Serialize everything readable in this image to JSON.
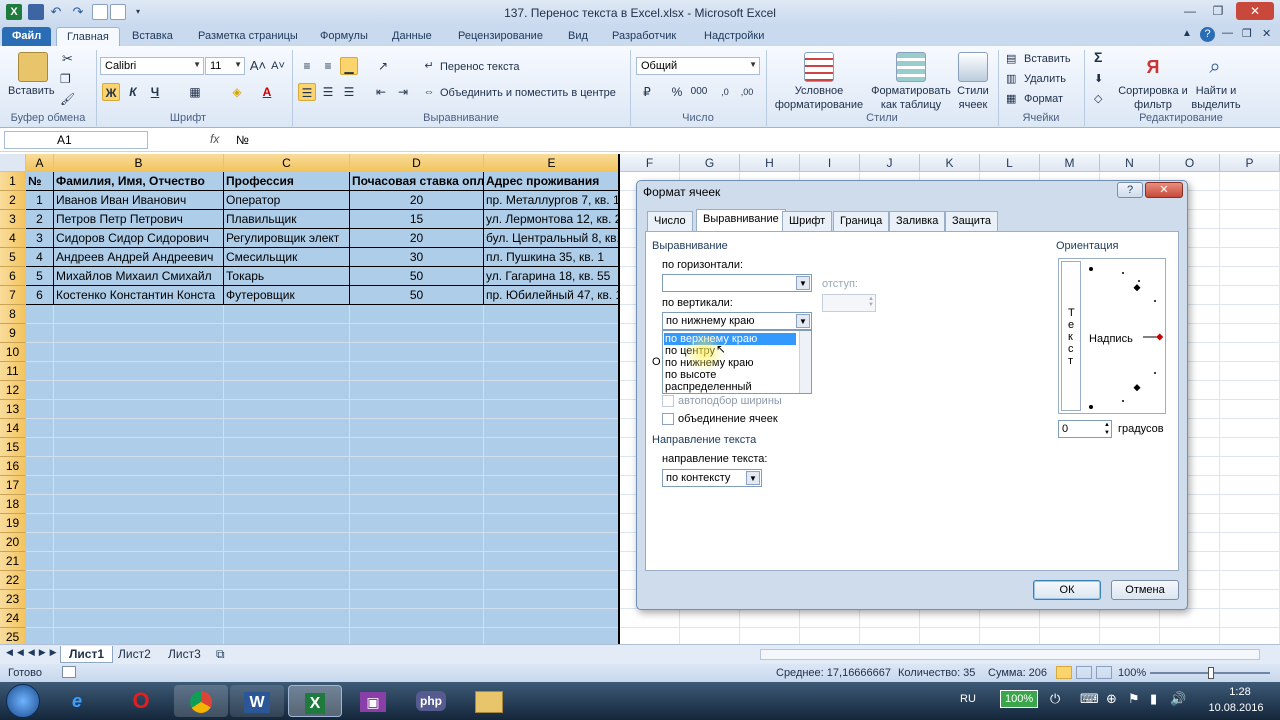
{
  "window": {
    "title": "137. Перенос текста в Excel.xlsx - Microsoft Excel"
  },
  "ribbon_tabs": [
    "Файл",
    "Главная",
    "Вставка",
    "Разметка страницы",
    "Формулы",
    "Данные",
    "Рецензирование",
    "Вид",
    "Разработчик",
    "Надстройки"
  ],
  "ribbon": {
    "clipboard": {
      "paste": "Вставить",
      "label": "Буфер обмена"
    },
    "font": {
      "name": "Calibri",
      "size": "11",
      "bold": "Ж",
      "italic": "К",
      "underline": "Ч",
      "label": "Шрифт"
    },
    "alignment": {
      "wrap": "Перенос текста",
      "merge": "Объединить и поместить в центре",
      "label": "Выравнивание"
    },
    "number": {
      "format": "Общий",
      "label": "Число"
    },
    "styles": {
      "conditional": "Условное форматирование",
      "as_table": "Форматировать как таблицу",
      "cell_styles": "Стили ячеек",
      "label": "Стили"
    },
    "cells": {
      "insert": "Вставить",
      "delete": "Удалить",
      "format": "Формат",
      "label": "Ячейки"
    },
    "editing": {
      "sort": "Сортировка и фильтр",
      "find": "Найти и выделить",
      "label": "Редактирование"
    }
  },
  "formula_bar": {
    "name_box": "A1",
    "fx": "fx",
    "value": "№"
  },
  "columns": [
    "A",
    "B",
    "C",
    "D",
    "E",
    "F",
    "G",
    "H",
    "I",
    "J",
    "K",
    "L",
    "M",
    "N",
    "O",
    "P"
  ],
  "rows": [
    "1",
    "2",
    "3",
    "4",
    "5",
    "6",
    "7",
    "8",
    "9",
    "10",
    "11",
    "12",
    "13",
    "14",
    "15",
    "16",
    "17",
    "18",
    "19",
    "20",
    "21",
    "22",
    "23",
    "24",
    "25"
  ],
  "table": {
    "headers": [
      "№",
      "Фамилия, Имя, Отчество",
      "Профессия",
      "Почасовая ставка опла",
      "Адрес проживания"
    ],
    "rows": [
      [
        "1",
        "Иванов Иван Иванович",
        "Оператор",
        "20",
        "пр. Металлургов 7, кв. 15"
      ],
      [
        "2",
        "Петров Петр Петрович",
        "Плавильщик",
        "15",
        "ул. Лермонтова 12, кв. 25"
      ],
      [
        "3",
        "Сидоров Сидор Сидорович",
        "Регулировщик элект",
        "20",
        "бул. Центральный 8, кв. 3"
      ],
      [
        "4",
        "Андреев Андрей Андреевич",
        "Смесильщик",
        "30",
        "пл. Пушкина 35, кв. 1"
      ],
      [
        "5",
        "Михайлов Михаил Смихайл",
        "Токарь",
        "50",
        "ул. Гагарина 18, кв. 55"
      ],
      [
        "6",
        "Костенко Константин Конста",
        "Футеровщик",
        "50",
        "пр. Юбилейный 47, кв. 12"
      ]
    ]
  },
  "sheet_tabs": [
    "Лист1",
    "Лист2",
    "Лист3"
  ],
  "status": {
    "ready": "Готово",
    "average": "Среднее: 17,16666667",
    "count": "Количество: 35",
    "sum": "Сумма: 206",
    "zoom": "100%"
  },
  "dialog": {
    "title": "Формат ячеек",
    "help": "?",
    "close": "✕",
    "tabs": [
      "Число",
      "Выравнивание",
      "Шрифт",
      "Граница",
      "Заливка",
      "Защита"
    ],
    "alignment_group": "Выравнивание",
    "horizontal_label": "по горизонтали:",
    "horizontal_value": "",
    "indent_label": "отступ:",
    "vertical_label": "по вертикали:",
    "vertical_value": "по нижнему краю",
    "vertical_options": [
      "по верхнему краю",
      "по центру",
      "по нижнему краю",
      "по высоте",
      "распределенный"
    ],
    "obscured_letter": "О",
    "shrink_label": "автоподбор ширины",
    "merge_label": "объединение ячеек",
    "direction_group": "Направление текста",
    "direction_label": "направление текста:",
    "direction_value": "по контексту",
    "orientation_group": "Ориентация",
    "vertical_text": [
      "Т",
      "е",
      "к",
      "с",
      "т"
    ],
    "inscription": "Надпись",
    "degrees_value": "0",
    "degrees_label": "градусов",
    "ok": "ОК",
    "cancel": "Отмена"
  },
  "taskbar": {
    "lang": "RU",
    "battery": "100%",
    "time": "1:28",
    "date": "10.08.2016"
  },
  "colors": {
    "accent": "#2a6db5",
    "selection": "#aecde9",
    "header_selected": "#f3c45e",
    "highlight": "#3399ff"
  }
}
